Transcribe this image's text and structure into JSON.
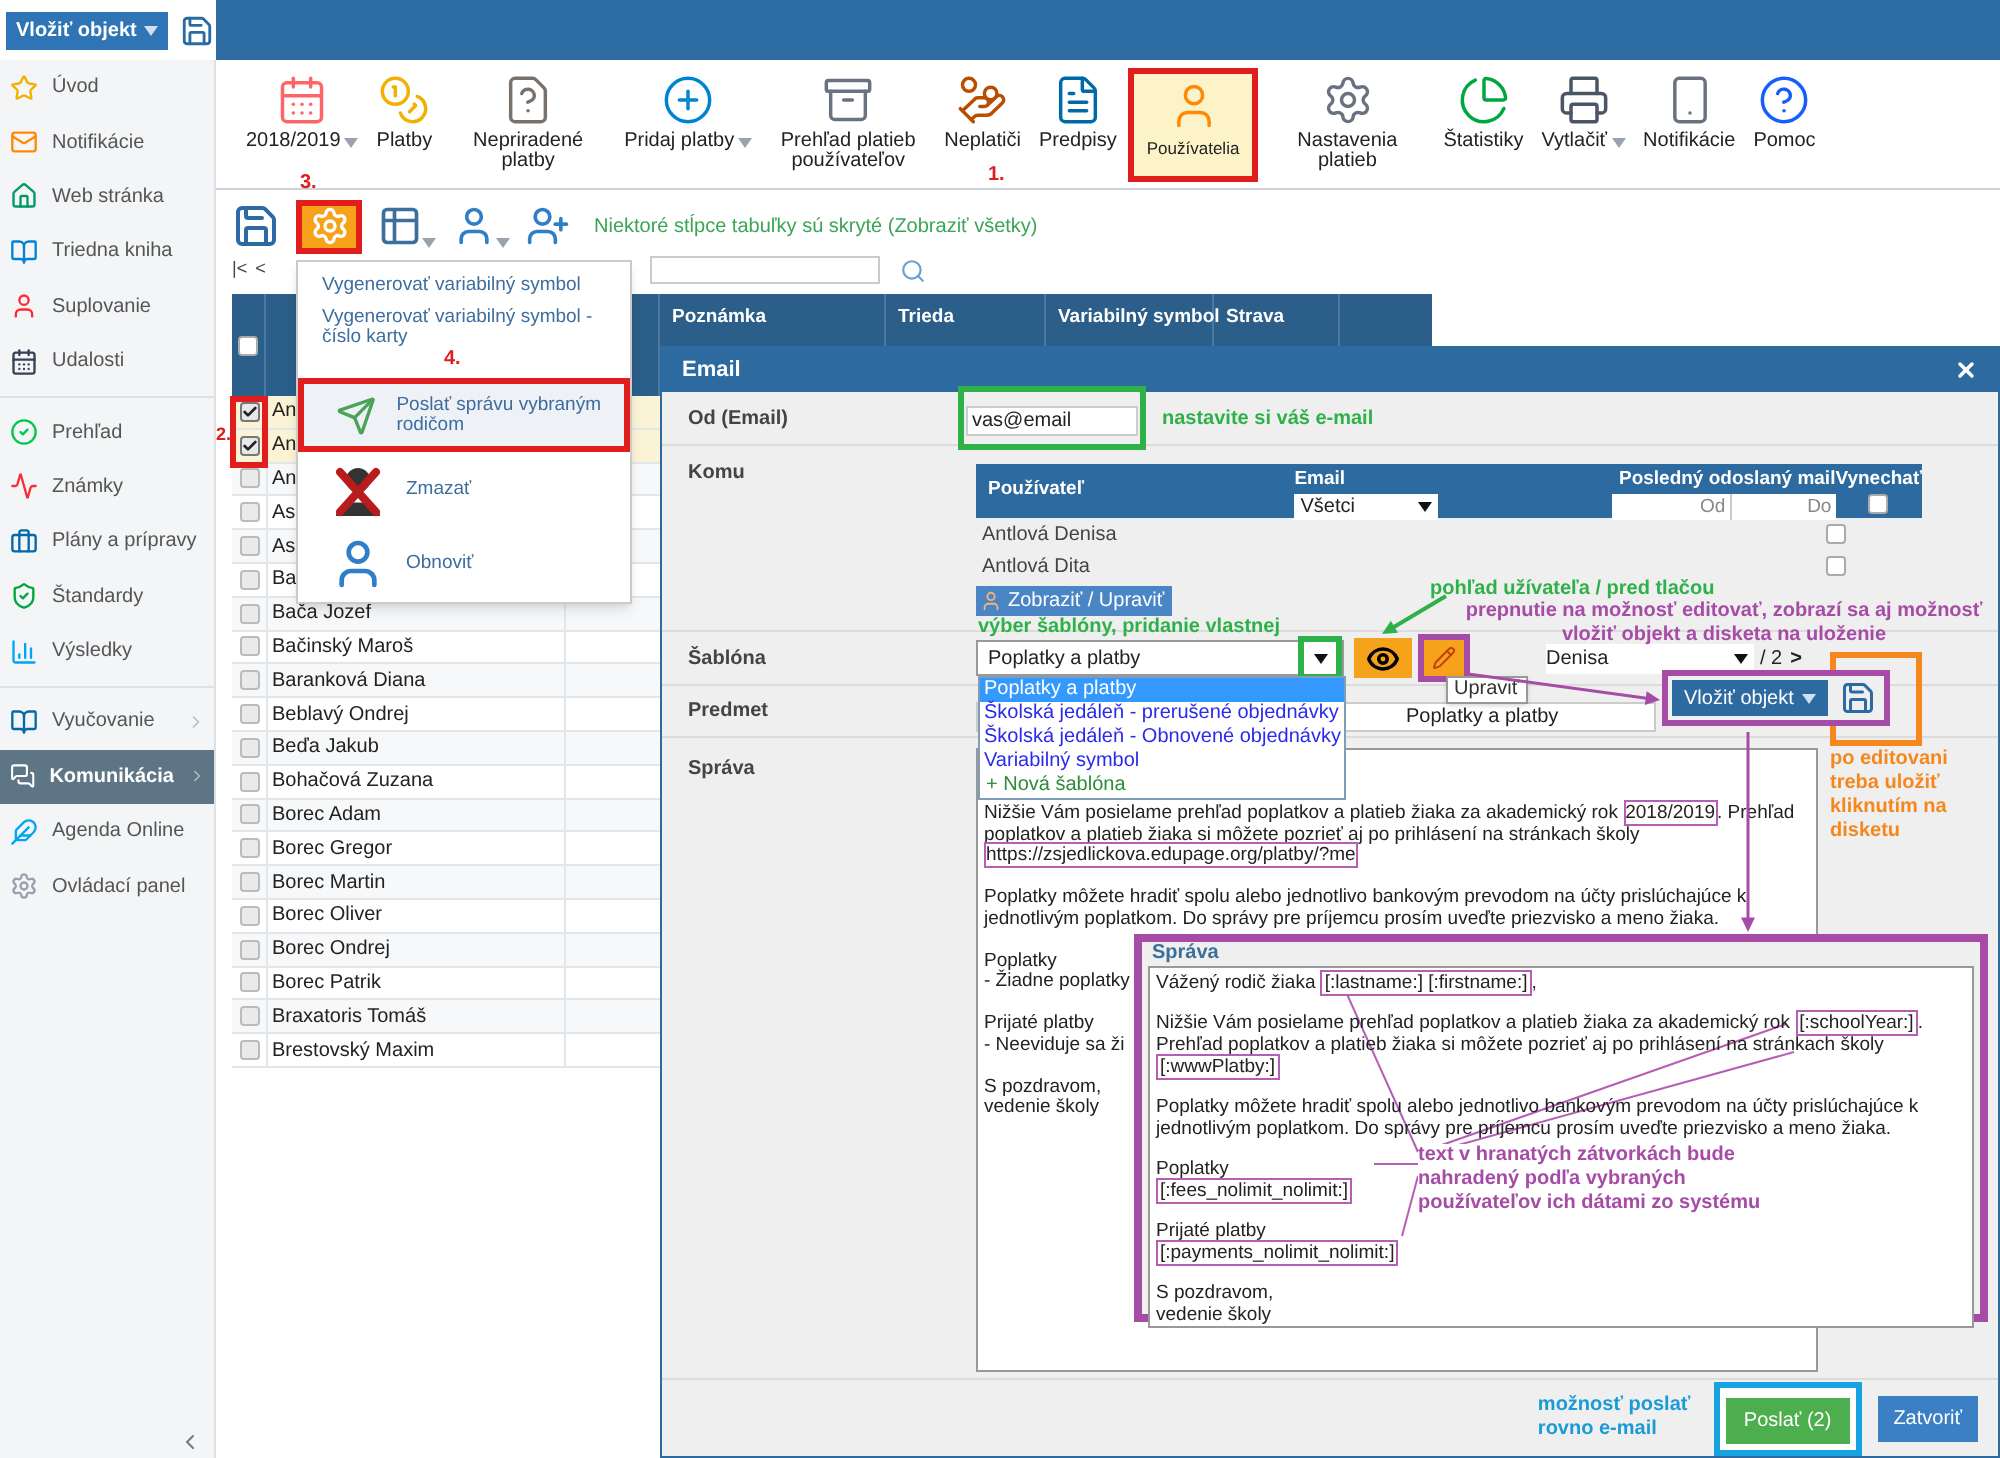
{
  "top_bar": {
    "insert_button": "Vložiť objekt"
  },
  "sidebar": {
    "groups": [
      {
        "items": [
          {
            "label": "Úvod",
            "selected": false,
            "submenu": false
          },
          {
            "label": "Notifikácie",
            "selected": false,
            "submenu": false
          },
          {
            "label": "Web stránka",
            "selected": false,
            "submenu": false
          },
          {
            "label": "Triedna kniha",
            "selected": false,
            "submenu": false
          },
          {
            "label": "Suplovanie",
            "selected": false,
            "submenu": false
          },
          {
            "label": "Udalosti",
            "selected": false,
            "submenu": false
          }
        ]
      },
      {
        "items": [
          {
            "label": "Prehľad",
            "selected": false,
            "submenu": false
          },
          {
            "label": "Známky",
            "selected": false,
            "submenu": false
          },
          {
            "label": "Plány a prípravy",
            "selected": false,
            "submenu": false
          },
          {
            "label": "Štandardy",
            "selected": false,
            "submenu": false
          },
          {
            "label": "Výsledky",
            "selected": false,
            "submenu": false
          }
        ]
      },
      {
        "items": [
          {
            "label": "Vyučovanie",
            "selected": false,
            "submenu": true
          },
          {
            "label": "Komunikácia",
            "selected": true,
            "submenu": true
          },
          {
            "label": "Agenda Online",
            "selected": false,
            "submenu": false
          },
          {
            "label": "Ovládací panel",
            "selected": false,
            "submenu": false
          }
        ]
      }
    ]
  },
  "toolbar": {
    "step_label": "1.",
    "items": [
      {
        "label": "2018/2019",
        "dropdown": true,
        "selected": false
      },
      {
        "label": "Platby",
        "dropdown": false,
        "selected": false
      },
      {
        "label": "Nepriradené platby",
        "dropdown": false,
        "selected": false
      },
      {
        "label": "Pridaj platby",
        "dropdown": true,
        "selected": false
      },
      {
        "label": "Prehľad platieb používateľov",
        "dropdown": false,
        "selected": false
      },
      {
        "label": "Neplatiči",
        "dropdown": false,
        "selected": false
      },
      {
        "label": "Predpisy",
        "dropdown": false,
        "selected": false
      },
      {
        "label": "Používatelia",
        "dropdown": false,
        "selected": true
      },
      {
        "label": "Nastavenia platieb",
        "dropdown": false,
        "selected": false
      },
      {
        "label": "Štatistiky",
        "dropdown": false,
        "selected": false
      },
      {
        "label": "Vytlačiť",
        "dropdown": true,
        "selected": false
      },
      {
        "label": "Notifikácie",
        "dropdown": false,
        "selected": false
      },
      {
        "label": "Pomoc",
        "dropdown": false,
        "selected": false
      }
    ]
  },
  "list_toolbar": {
    "step_label": "3.",
    "settings_open": true,
    "notice": "Niektoré stĺpce tabuľky sú skryté (Zobraziť všetky)"
  },
  "pager": {
    "first": "|<",
    "prev": "<"
  },
  "table": {
    "step_label": "2.",
    "columns": [
      "Poznámka",
      "Trieda",
      "Variabilný symbol",
      "Strava"
    ],
    "header_checked": false,
    "rows": [
      {
        "name": "An",
        "checked": true
      },
      {
        "name": "An",
        "checked": true
      },
      {
        "name": "An",
        "checked": false
      },
      {
        "name": "As",
        "checked": false
      },
      {
        "name": "As",
        "checked": false
      },
      {
        "name": "Ba",
        "checked": false
      },
      {
        "name": "Bača Jozef",
        "checked": false
      },
      {
        "name": "Bačinský Maroš",
        "checked": false
      },
      {
        "name": "Baranková Diana",
        "checked": false
      },
      {
        "name": "Beblavý Ondrej",
        "checked": false
      },
      {
        "name": "Beďa Jakub",
        "checked": false
      },
      {
        "name": "Bohačová Zuzana",
        "checked": false
      },
      {
        "name": "Borec Adam",
        "checked": false
      },
      {
        "name": "Borec Gregor",
        "checked": false
      },
      {
        "name": "Borec Martin",
        "checked": false
      },
      {
        "name": "Borec Oliver",
        "checked": false
      },
      {
        "name": "Borec Ondrej",
        "checked": false
      },
      {
        "name": "Borec Patrik",
        "checked": false
      },
      {
        "name": "Braxatoris Tomáš",
        "checked": false
      },
      {
        "name": "Brestovský Maxim",
        "checked": false
      }
    ]
  },
  "action_menu": {
    "step_label": "4.",
    "items": [
      {
        "label": "Vygenerovať variabilný symbol",
        "kind": "text",
        "selected": false
      },
      {
        "label": "Vygenerovať variabilný symbol - číslo karty",
        "kind": "text",
        "selected": false
      },
      {
        "label": "Poslať správu vybraným rodičom",
        "kind": "send",
        "selected": true
      },
      {
        "label": "Zmazať",
        "kind": "delete",
        "selected": false
      },
      {
        "label": "Obnoviť",
        "kind": "restore",
        "selected": false
      }
    ]
  },
  "dialog": {
    "title": "Email",
    "from": {
      "label": "Od (Email)",
      "value": "vas@email",
      "note": "nastavite si váš e-mail"
    },
    "to": {
      "label": "Komu",
      "user_column": "Používateľ",
      "email_column": "Email",
      "email_filter": "Všetci",
      "last_sent_column": "Posledný odoslaný mail",
      "from_placeholder": "Od",
      "to_placeholder": "Do",
      "skip_column": "Vynechať",
      "skip_all": false,
      "rows": [
        {
          "name": "Antlová Denisa",
          "skip": false
        },
        {
          "name": "Antlová Dita",
          "skip": false
        }
      ],
      "show_button": "Zobraziť / Upraviť"
    },
    "template": {
      "label": "Šablóna",
      "value": "Poplatky a platby",
      "open": true,
      "options": [
        {
          "label": "Poplatky a platby",
          "kind": "template",
          "selected": true
        },
        {
          "label": "Školská jedáleň - prerušené objednávky",
          "kind": "template",
          "selected": false
        },
        {
          "label": "Školská jedáleň - Obnovené objednávky",
          "kind": "template",
          "selected": false
        },
        {
          "label": "Variabilný symbol",
          "kind": "template",
          "selected": false
        },
        {
          "label": "+ Nová šablóna",
          "kind": "new",
          "selected": false
        }
      ],
      "note": "výber šablóny, pridanie vlastnej",
      "preview_note": "pohľad užívateľa / pred tlačou",
      "edit_note": "prepnutie na možnosť editovať, zobrazí sa aj možnosť vložiť objekt a disketa na uloženie",
      "edit_tooltip": "Upraviť",
      "recipient": "Denisa",
      "recipient_count": "/ 2",
      "next": ">"
    },
    "subject": {
      "label": "Predmet",
      "value": "Poplatky a platby"
    },
    "insert_button": "Vložiť objekt",
    "save_note": "po editovani treba uložiť kliknutím na disketu",
    "message": {
      "label": "Správa",
      "paragraphs": [
        [
          {
            "text": "Nižšie Vám posielame prehľad poplatkov a platieb žiaka za akademický rok ",
            "marked": false
          },
          {
            "text": "2018/2019",
            "marked": true
          },
          {
            "text": ". Prehľad poplatkov a platieb žiaka si môžete pozrieť aj po prihlásení na stránkach školy ",
            "marked": false
          },
          {
            "text": "https://zsjedlickova.edupage.org/platby/?me",
            "marked": true
          }
        ],
        [
          {
            "text": "Poplatky môžete hradiť spolu alebo jednotlivo bankovým prevodom na účty prislúchajúce k jednotlivým poplatkom. Do správy pre príjemcu prosím uveďte priezvisko a meno žiaka.",
            "marked": false
          }
        ],
        [
          {
            "text": "Poplatky\n- Žiadne poplatky",
            "marked": false
          }
        ],
        [
          {
            "text": "Prijaté platby\n- Neeviduje sa ži",
            "marked": false
          }
        ],
        [
          {
            "text": "S pozdravom,\nvedenie školy",
            "marked": false
          }
        ]
      ]
    },
    "template_view": {
      "title": "Správa",
      "note": "text v hranatých zátvorkách bude nahradený podľa vybraných používateľov ich dátami zo systému",
      "paragraphs": [
        [
          {
            "text": "Vážený rodič žiaka ",
            "marked": false
          },
          {
            "text": "[:lastname:] [:firstname:]",
            "marked": true
          },
          {
            "text": ",",
            "marked": false
          }
        ],
        [
          {
            "text": "Nižšie Vám posielame prehľad poplatkov a platieb žiaka za akademický rok ",
            "marked": false
          },
          {
            "text": "[:schoolYear:]",
            "marked": true
          },
          {
            "text": ". Prehľad poplatkov a platieb žiaka si môžete pozrieť aj po prihlásení na stránkach školy ",
            "marked": false
          },
          {
            "text": "[:wwwPlatby:]",
            "marked": true
          }
        ],
        [
          {
            "text": "Poplatky môžete hradiť spolu alebo jednotlivo bankovým prevodom na účty prislúchajúce k jednotlivým poplatkom. Do správy pre príjemcu prosím uveďte priezvisko a meno žiaka.",
            "marked": false
          }
        ],
        [
          {
            "text": "Poplatky\n",
            "marked": false
          },
          {
            "text": "[:fees_nolimit_nolimit:]",
            "marked": true
          }
        ],
        [
          {
            "text": "Prijaté platby\n",
            "marked": false
          },
          {
            "text": "[:payments_nolimit_nolimit:]",
            "marked": true
          }
        ],
        [
          {
            "text": "S pozdravom,\nvedenie školy",
            "marked": false
          }
        ]
      ]
    },
    "send_note": "možnosť poslať rovno e-mail",
    "send_button": "Poslať (2)",
    "close_button": "Zatvoriť"
  }
}
